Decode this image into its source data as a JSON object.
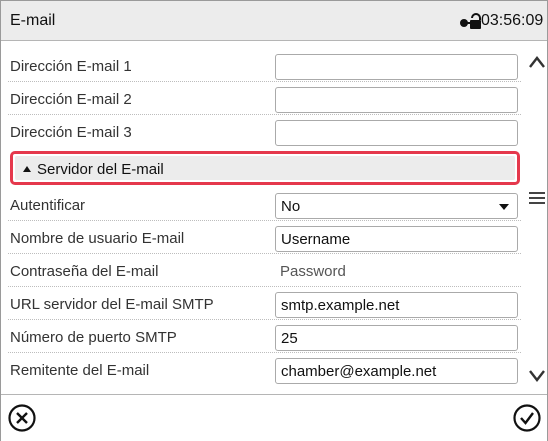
{
  "header": {
    "title": "E-mail",
    "clock": "03:56:09",
    "lock_icon": "padlock-key-icon"
  },
  "rows_top": [
    {
      "label": "Dirección E-mail 1",
      "value": ""
    },
    {
      "label": "Dirección E-mail 2",
      "value": ""
    },
    {
      "label": "Dirección E-mail 3",
      "value": ""
    }
  ],
  "section": {
    "label": "Servidor del E-mail",
    "expanded": true,
    "highlight_color": "#e5384c"
  },
  "rows_server": [
    {
      "label": "Autentificar",
      "value": "No",
      "kind": "select"
    },
    {
      "label": "Nombre de usuario E-mail",
      "value": "Username",
      "kind": "input"
    },
    {
      "label": "Contraseña del E-mail",
      "value": "Password",
      "kind": "plain"
    },
    {
      "label": "URL servidor del E-mail SMTP",
      "value": "smtp.example.net",
      "kind": "input"
    },
    {
      "label": "Número de puerto SMTP",
      "value": "25",
      "kind": "input"
    },
    {
      "label": "Remitente del E-mail",
      "value": "chamber@example.net",
      "kind": "input"
    }
  ],
  "side_icons": [
    "chevron-up-icon",
    "hamburger-menu-icon",
    "chevron-down-icon"
  ],
  "footer": {
    "cancel_icon": "circle-x-icon",
    "confirm_icon": "circle-check-icon"
  }
}
